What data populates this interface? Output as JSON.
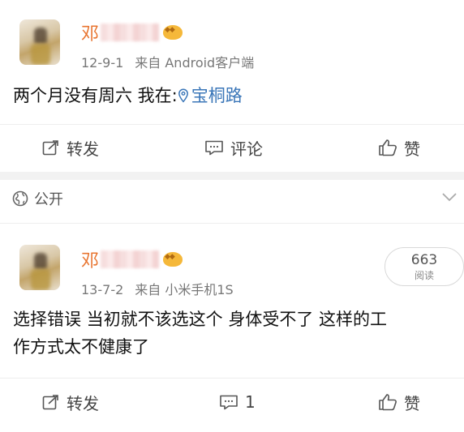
{
  "post1": {
    "author": "邓",
    "date": "12-9-1",
    "source": "来自 Android客户端",
    "text": "两个月没有周六 我在:",
    "location": "宝桐路",
    "actions": {
      "repost": "转发",
      "comment": "评论",
      "like": "赞"
    }
  },
  "privacy_label": "公开",
  "post2": {
    "author": "邓",
    "date": "13-7-2",
    "source": "来自 小米手机1S",
    "text_line1": "选择错误 当初就不该选这个 身体受不了 这样的工",
    "text_line2": "作方式太不健康了",
    "read_count": "663",
    "read_label": "阅读",
    "actions": {
      "repost": "转发",
      "comment": "1",
      "like": "赞"
    }
  },
  "colors": {
    "name": "#e8742f",
    "location": "#3a76b8",
    "meta": "#777777"
  },
  "icons": [
    "share-icon",
    "comment-icon",
    "like-icon",
    "globe-icon",
    "chevron-down-icon",
    "location-pin-icon",
    "vip-badge-icon"
  ]
}
